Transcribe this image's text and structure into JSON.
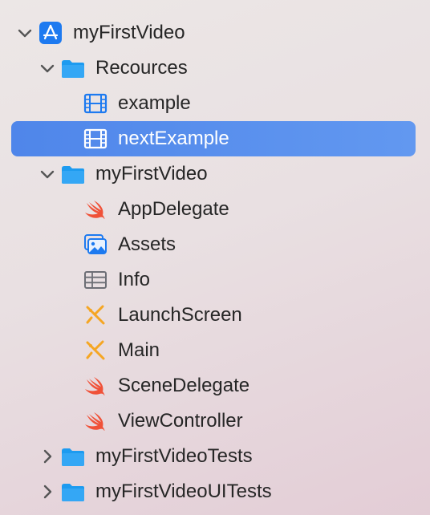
{
  "colors": {
    "selection": "#5b90ee",
    "folder": "#1d9bf0",
    "swift": "#f05138",
    "interface_builder": "#f5a623",
    "chevron": "#555555",
    "text": "#262626"
  },
  "tree": {
    "project": {
      "label": "myFirstVideo",
      "icon": "xcode-project-icon",
      "expanded": true
    },
    "resources_group": {
      "label": "Recources",
      "icon": "folder-icon",
      "expanded": true
    },
    "example_file": {
      "label": "example",
      "icon": "video-file-icon"
    },
    "next_example_file": {
      "label": "nextExample",
      "icon": "video-file-icon",
      "selected": true
    },
    "source_group": {
      "label": "myFirstVideo",
      "icon": "folder-icon",
      "expanded": true
    },
    "app_delegate": {
      "label": "AppDelegate",
      "icon": "swift-icon"
    },
    "assets": {
      "label": "Assets",
      "icon": "asset-catalog-icon"
    },
    "info": {
      "label": "Info",
      "icon": "plist-icon"
    },
    "launch_screen": {
      "label": "LaunchScreen",
      "icon": "storyboard-icon"
    },
    "main": {
      "label": "Main",
      "icon": "storyboard-icon"
    },
    "scene_delegate": {
      "label": "SceneDelegate",
      "icon": "swift-icon"
    },
    "view_controller": {
      "label": "ViewController",
      "icon": "swift-icon"
    },
    "tests_group": {
      "label": "myFirstVideoTests",
      "icon": "folder-icon",
      "expanded": false
    },
    "ui_tests_group": {
      "label": "myFirstVideoUITests",
      "icon": "folder-icon",
      "expanded": false
    }
  }
}
